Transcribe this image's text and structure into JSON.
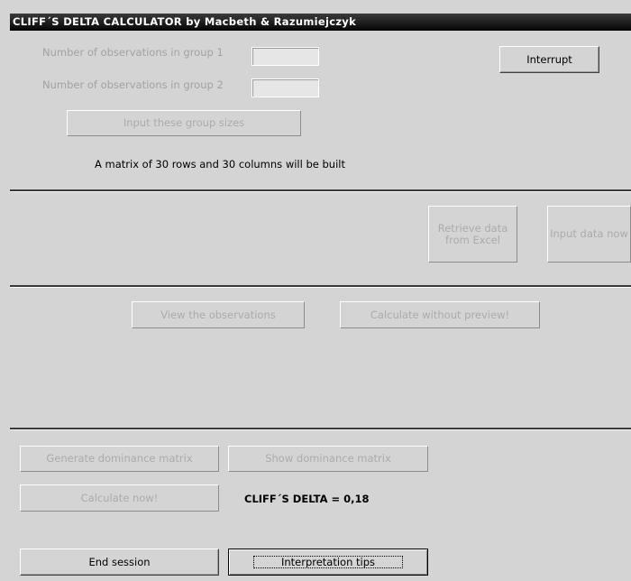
{
  "window": {
    "title": "CLIFF´S DELTA CALCULATOR by Macbeth & Razumiejczyk"
  },
  "group_sizes": {
    "group1_label": "Number of observations in group 1",
    "group1_value": "",
    "group2_label": "Number of observations in group 2",
    "group2_value": "",
    "input_button": "Input these group sizes",
    "matrix_message": "A matrix of 30 rows and 30 columns will be built"
  },
  "controls": {
    "interrupt_button": "Interrupt"
  },
  "data_input": {
    "retrieve_button": "Retrieve data from Excel",
    "input_now_button": "Input data now"
  },
  "preview": {
    "view_button": "View the observations",
    "calculate_without_preview_button": "Calculate without preview!"
  },
  "dominance": {
    "generate_button": "Generate dominance matrix",
    "show_button": "Show dominance matrix",
    "calculate_now_button": "Calculate now!",
    "result_text": "CLIFF´S DELTA = 0,18"
  },
  "footer": {
    "end_session_button": "End session",
    "interpretation_button": "Interpretation tips"
  }
}
